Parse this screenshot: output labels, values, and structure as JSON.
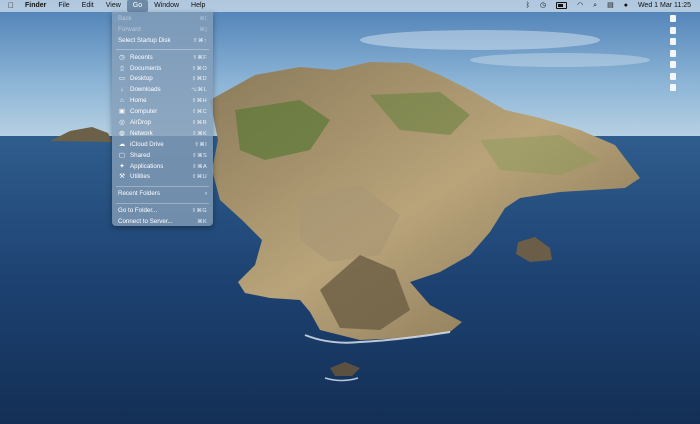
{
  "menubar": {
    "apple_icon": "apple-logo-icon",
    "app_name": "Finder",
    "menus": [
      "File",
      "Edit",
      "View",
      "Go",
      "Window",
      "Help"
    ],
    "active_menu": "Go",
    "date_time": "Wed 1 Mar  11:25"
  },
  "go_menu": {
    "header_items": [
      {
        "label": "Back",
        "shortcut": "⌘[",
        "enabled": false
      },
      {
        "label": "Forward",
        "shortcut": "⌘]",
        "enabled": false
      },
      {
        "label": "Select Startup Disk",
        "shortcut": "⇧⌘↑",
        "enabled": true
      }
    ],
    "location_items": [
      {
        "label": "Recents",
        "shortcut": "⇧⌘F",
        "icon": "clock-icon"
      },
      {
        "label": "Documents",
        "shortcut": "⇧⌘O",
        "icon": "document-icon"
      },
      {
        "label": "Desktop",
        "shortcut": "⇧⌘D",
        "icon": "desktop-icon"
      },
      {
        "label": "Downloads",
        "shortcut": "⌥⌘L",
        "icon": "download-icon"
      },
      {
        "label": "Home",
        "shortcut": "⇧⌘H",
        "icon": "home-icon"
      },
      {
        "label": "Computer",
        "shortcut": "⇧⌘C",
        "icon": "computer-icon"
      },
      {
        "label": "AirDrop",
        "shortcut": "⇧⌘R",
        "icon": "airdrop-icon"
      },
      {
        "label": "Network",
        "shortcut": "⇧⌘K",
        "icon": "network-icon"
      },
      {
        "label": "iCloud Drive",
        "shortcut": "⇧⌘I",
        "icon": "cloud-icon"
      },
      {
        "label": "Shared",
        "shortcut": "⇧⌘S",
        "icon": "shared-folder-icon"
      },
      {
        "label": "Applications",
        "shortcut": "⇧⌘A",
        "icon": "applications-icon"
      },
      {
        "label": "Utilities",
        "shortcut": "⇧⌘U",
        "icon": "utilities-icon"
      }
    ],
    "recent_folders": {
      "label": "Recent Folders",
      "arrow": "›"
    },
    "footer_items": [
      {
        "label": "Go to Folder...",
        "shortcut": "⇧⌘G"
      },
      {
        "label": "Connect to Server...",
        "shortcut": "⌘K"
      }
    ]
  }
}
